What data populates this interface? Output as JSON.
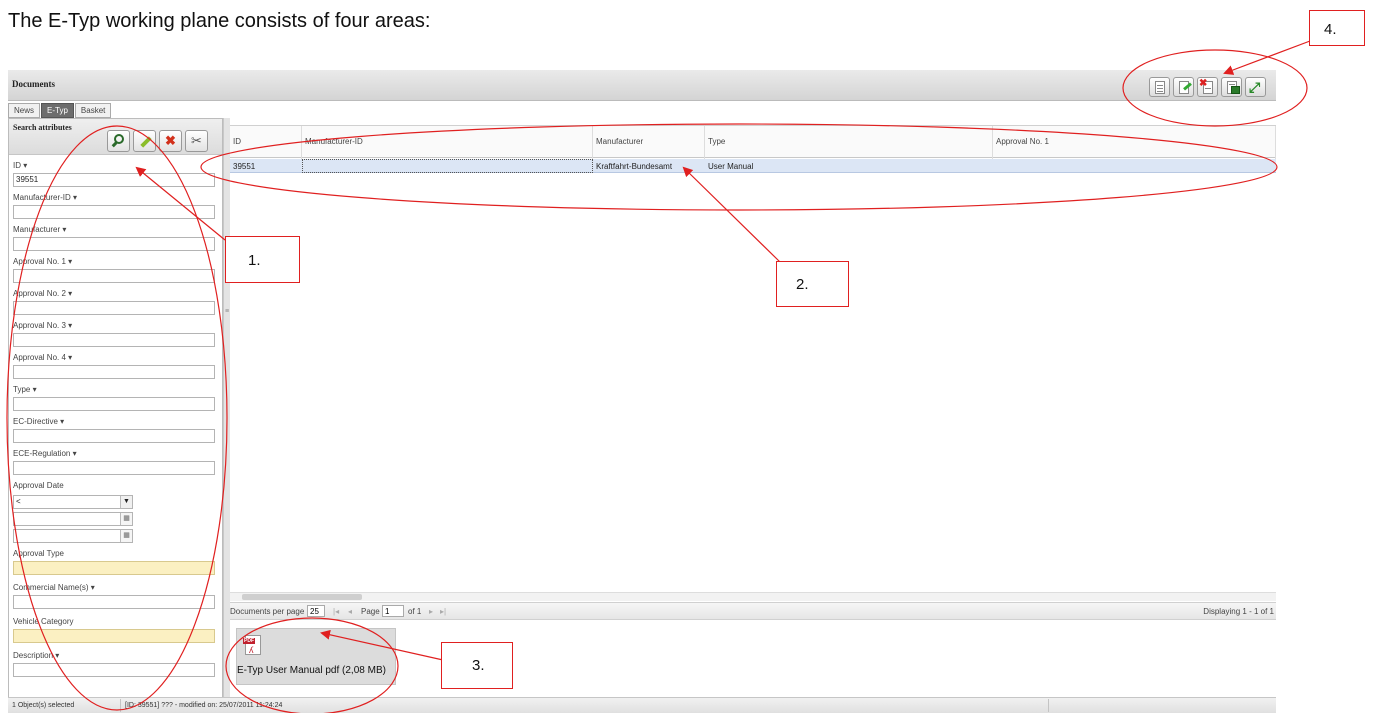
{
  "intro_heading": "The E-Typ working plane consists of four areas:",
  "colors": {
    "annotation": "#e02020",
    "selected_row": "#dce6f5",
    "active_tab": "#6d6d6d",
    "required_field": "#fbf0c2"
  },
  "header": {
    "title": "Documents",
    "toolbar_icons": [
      "new-document-icon",
      "edit-document-icon",
      "delete-document-icon",
      "excel-export-icon",
      "expand-icon"
    ]
  },
  "tabs": [
    {
      "label": "News",
      "active": false
    },
    {
      "label": "E-Typ",
      "active": true
    },
    {
      "label": "Basket",
      "active": false
    }
  ],
  "search_panel": {
    "title": "Search attributes",
    "tool_icons": [
      "search-icon",
      "clear-icon",
      "delete-icon",
      "settings-icon"
    ],
    "fields": {
      "id": {
        "label": "ID ▾",
        "value": "39551"
      },
      "manufacturer_id": {
        "label": "Manufacturer-ID ▾",
        "value": ""
      },
      "manufacturer": {
        "label": "Manufacturer ▾",
        "value": ""
      },
      "approval_1": {
        "label": "Approval No. 1 ▾",
        "value": ""
      },
      "approval_2": {
        "label": "Approval No. 2 ▾",
        "value": ""
      },
      "approval_3": {
        "label": "Approval No. 3 ▾",
        "value": ""
      },
      "approval_4": {
        "label": "Approval No. 4 ▾",
        "value": ""
      },
      "type": {
        "label": "Type ▾",
        "value": ""
      },
      "ec_directive": {
        "label": "EC-Directive ▾",
        "value": ""
      },
      "ece_regulation": {
        "label": "ECE-Regulation ▾",
        "value": ""
      },
      "approval_date": {
        "label": "Approval Date",
        "operator": "<"
      },
      "approval_type": {
        "label": "Approval Type",
        "value": ""
      },
      "commercial_names": {
        "label": "Commercial Name(s) ▾",
        "value": ""
      },
      "vehicle_category": {
        "label": "Vehicle Category",
        "value": ""
      },
      "description": {
        "label": "Description ▾",
        "value": ""
      }
    }
  },
  "grid": {
    "columns": [
      "ID",
      "Manufacturer-ID",
      "Manufacturer",
      "Type",
      "Approval No. 1"
    ],
    "rows": [
      {
        "id": "39551",
        "manufacturer_id": "",
        "manufacturer": "Kraftfahrt-Bundesamt",
        "type": "User Manual",
        "approval_1": ""
      }
    ]
  },
  "pager": {
    "per_page_label": "Documents per page",
    "per_page_value": "25",
    "page_label": "Page",
    "page_value": "1",
    "of_label": "of 1",
    "display_text": "Displaying 1 - 1 of 1"
  },
  "attachment": {
    "icon": "pdf-file-icon",
    "icon_tag": "PDF",
    "label": "E-Typ User Manual pdf (2,08 MB)"
  },
  "status_bar": {
    "selection": "1 Object(s) selected",
    "info": "[ID: 39551] ??? - modified on: 25/07/2011 11:24:24"
  },
  "callouts": [
    "1.",
    "2.",
    "3.",
    "4."
  ]
}
